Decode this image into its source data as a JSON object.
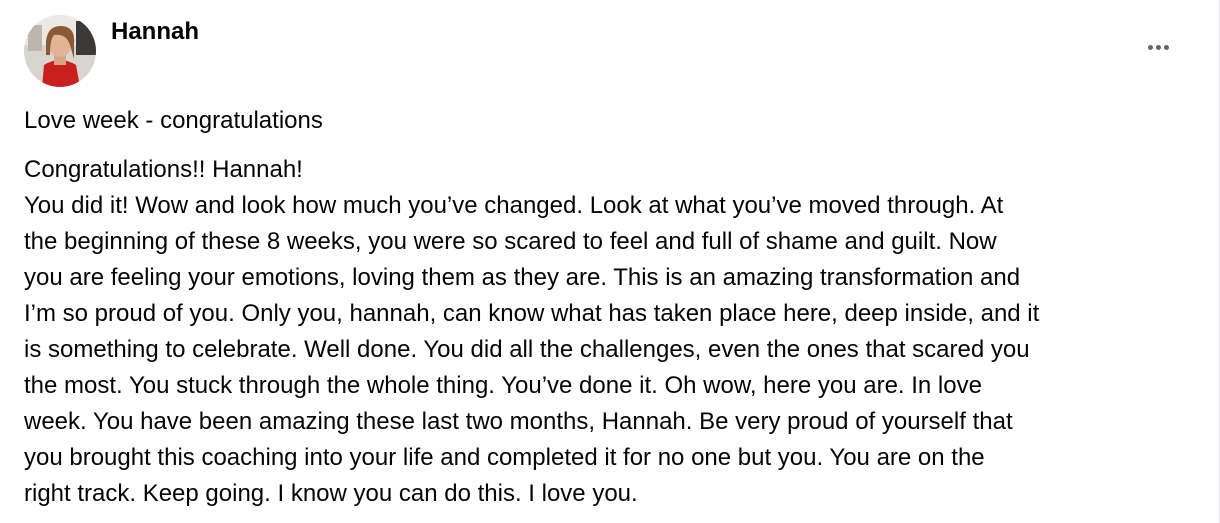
{
  "post": {
    "author": "Hannah",
    "avatar_icon": "profile-photo",
    "more_icon": "ellipsis-icon",
    "title": "Love week - congratulations",
    "greeting": "Congratulations!! Hannah!",
    "body_lines": [
      "You did it! Wow and look how much you’ve changed. Look at what you’ve moved through. At",
      "the beginning of these 8 weeks, you were so scared to feel and full of shame and guilt. Now",
      "you are feeling your emotions, loving them as they are. This is an amazing transformation and",
      "I’m so proud of you. Only you, hannah, can know what has taken place here, deep inside, and it",
      "is something to celebrate. Well done. You did all the challenges, even the ones that scared you",
      "the most. You stuck through the whole thing. You’ve done it. Oh wow, here you are. In love",
      "week. You have been amazing these last two months, Hannah. Be very proud of yourself that",
      "you brought this coaching into your life and completed it for no one but you. You are on the",
      "right track. Keep going. I know you can do this. I love you."
    ]
  }
}
